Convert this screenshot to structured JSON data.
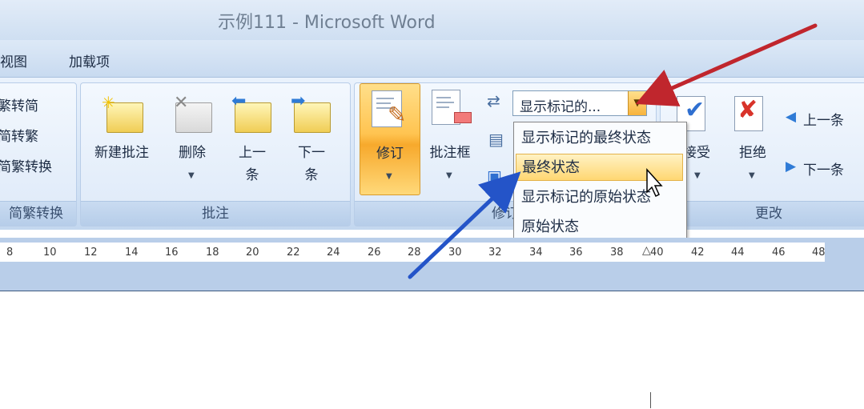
{
  "window": {
    "title": "示例111 - Microsoft Word"
  },
  "menu": {
    "view": "视图",
    "addins": "加载项"
  },
  "ribbon": {
    "chinese_group": {
      "to_simplified": "繁转简",
      "to_traditional": "简转繁",
      "convert": "简繁转换",
      "label": "简繁转换"
    },
    "comments_group": {
      "new_comment": "新建批注",
      "delete": "删除",
      "previous_line1": "上一",
      "previous_line2": "条",
      "next_line1": "下一",
      "next_line2": "条",
      "label": "批注"
    },
    "tracking_group": {
      "track_changes": "修订",
      "balloons": "批注框",
      "label": "修订",
      "display_combo": "显示标记的...",
      "dropdown_options": [
        "显示标记的最终状态",
        "最终状态",
        "显示标记的原始状态",
        "原始状态"
      ],
      "selected_option": "最终状态"
    },
    "changes_group": {
      "accept": "接受",
      "reject": "拒绝",
      "previous": "上一条",
      "next": "下一条",
      "label": "更改"
    }
  },
  "ruler": {
    "numbers": [
      "8",
      "10",
      "12",
      "14",
      "16",
      "18",
      "20",
      "22",
      "24",
      "26",
      "28",
      "30",
      "32",
      "34",
      "36",
      "38",
      "40",
      "42",
      "44",
      "46",
      "48"
    ]
  },
  "colors": {
    "annotation_red": "#c0262d",
    "annotation_blue": "#2454c8",
    "active_orange": "#ffc451"
  }
}
